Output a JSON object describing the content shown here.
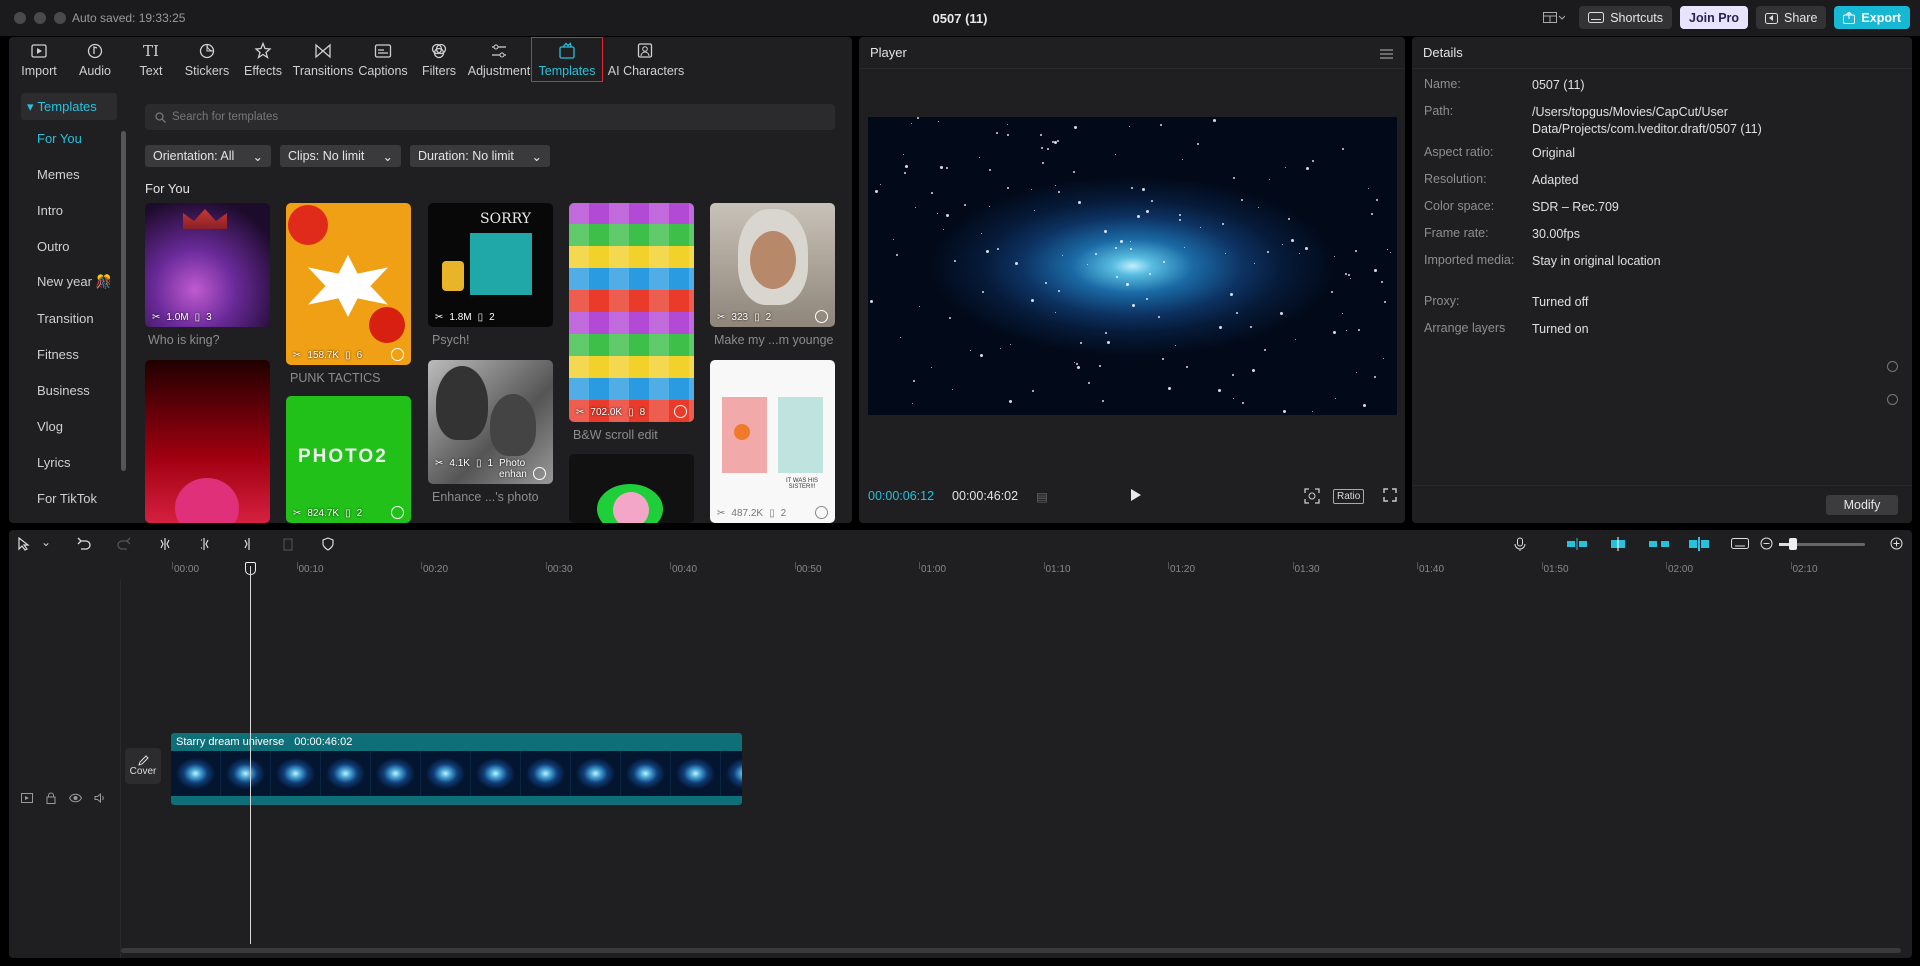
{
  "titlebar": {
    "autosave": "Auto saved: 19:33:25",
    "project_title": "0507 (11)",
    "shortcuts_label": "Shortcuts",
    "joinpro_label": "Join Pro",
    "share_label": "Share",
    "export_label": "Export"
  },
  "toolbar": {
    "items": [
      {
        "label": "Import",
        "icon": "import-icon"
      },
      {
        "label": "Audio",
        "icon": "audio-icon"
      },
      {
        "label": "Text",
        "icon": "text-icon"
      },
      {
        "label": "Stickers",
        "icon": "stickers-icon"
      },
      {
        "label": "Effects",
        "icon": "effects-icon"
      },
      {
        "label": "Transitions",
        "icon": "transitions-icon"
      },
      {
        "label": "Captions",
        "icon": "captions-icon"
      },
      {
        "label": "Filters",
        "icon": "filters-icon"
      },
      {
        "label": "Adjustment",
        "icon": "adjustment-icon"
      },
      {
        "label": "Templates",
        "icon": "templates-icon",
        "active": true
      },
      {
        "label": "AI Characters",
        "icon": "ai-characters-icon"
      }
    ]
  },
  "sidebar": {
    "header": "Templates",
    "items": [
      "For You",
      "Memes",
      "Intro",
      "Outro",
      "New year 🎊",
      "Transition",
      "Fitness",
      "Business",
      "Vlog",
      "Lyrics",
      "For TikTok"
    ],
    "active": "For You"
  },
  "search": {
    "placeholder": "Search for templates"
  },
  "filters": {
    "orientation": "Orientation: All",
    "clips": "Clips: No limit",
    "duration": "Duration: No limit"
  },
  "section_title": "For You",
  "cards": [
    {
      "title": "Who is king?",
      "uses": "1.0M",
      "clips": "3"
    },
    {
      "title": "PUNK TACTICS",
      "uses": "158.7K",
      "clips": "6"
    },
    {
      "title": "Psych!",
      "uses": "1.8M",
      "clips": "2"
    },
    {
      "title": "B&W scroll edit",
      "uses": "702.0K",
      "clips": "8"
    },
    {
      "title": "Make my ...m younge",
      "uses": "323",
      "clips": "2"
    },
    {
      "title": "",
      "uses": "824.7K",
      "clips": "2"
    },
    {
      "title": "Enhance ...'s photo",
      "uses": "4.1K",
      "clips": "1"
    },
    {
      "title": "",
      "uses": "487.2K",
      "clips": "2"
    }
  ],
  "card_texts": {
    "sorry": "SORRY",
    "photo2": "PHOTO2",
    "photo_enhance": "Photo enhan",
    "it_was_his": "IT WAS HIS SISTER!!!"
  },
  "player": {
    "title": "Player",
    "current_time": "00:00:06:12",
    "total_time": "00:00:46:02",
    "ratio_label": "Ratio"
  },
  "details": {
    "title": "Details",
    "rows": [
      {
        "key": "Name:",
        "value": "0507 (11)"
      },
      {
        "key": "Path:",
        "value": "/Users/topgus/Movies/CapCut/User Data/Projects/com.lveditor.draft/0507 (11)"
      },
      {
        "key": "Aspect ratio:",
        "value": "Original"
      },
      {
        "key": "Resolution:",
        "value": "Adapted"
      },
      {
        "key": "Color space:",
        "value": "SDR – Rec.709"
      },
      {
        "key": "Frame rate:",
        "value": "30.00fps"
      },
      {
        "key": "Imported media:",
        "value": "Stay in original location"
      },
      {
        "key": "Proxy:",
        "value": "Turned off"
      },
      {
        "key": "Arrange layers",
        "value": "Turned on"
      }
    ],
    "modify_label": "Modify"
  },
  "timeline": {
    "ruler": [
      "00:00",
      "00:10",
      "00:20",
      "00:30",
      "00:40",
      "00:50",
      "01:00",
      "01:10",
      "01:20",
      "01:30",
      "01:40",
      "01:50",
      "02:00",
      "02:10"
    ],
    "cover_label": "Cover",
    "clip_name": "Starry dream universe",
    "clip_duration": "00:00:46:02"
  },
  "colors": {
    "accent": "#28c0dc",
    "highlight_box": "#e0262f",
    "clip": "#0f6f78",
    "panel": "#1f1f21"
  }
}
